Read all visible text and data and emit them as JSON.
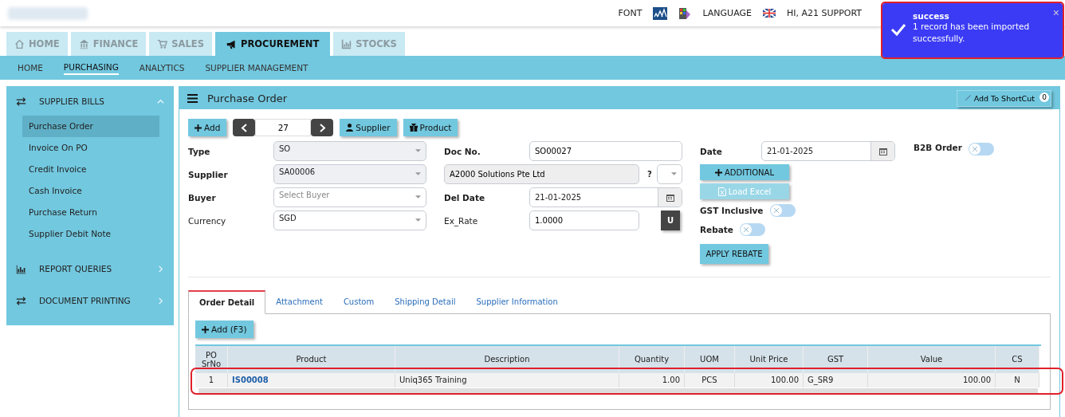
{
  "header": {
    "font_label": "FONT",
    "language_label": "LANGUAGE",
    "user": "HI, A21 SUPPORT"
  },
  "toast": {
    "title": "success",
    "message": "1 record has been imported successfully.",
    "close": "×",
    "highlighted": true
  },
  "module_tabs": [
    {
      "label": "HOME",
      "selected": false
    },
    {
      "label": "FINANCE",
      "selected": false
    },
    {
      "label": "SALES",
      "selected": false
    },
    {
      "label": "PROCUREMENT",
      "selected": true
    },
    {
      "label": "STOCKS",
      "selected": false
    }
  ],
  "sub_nav": [
    {
      "label": "HOME",
      "selected": false
    },
    {
      "label": "PURCHASING",
      "selected": true
    },
    {
      "label": "ANALYTICS",
      "selected": false
    },
    {
      "label": "SUPPLIER MANAGEMENT",
      "selected": false
    }
  ],
  "sidebar": {
    "groups": [
      {
        "label": "SUPPLIER BILLS",
        "expanded": true,
        "items": [
          {
            "label": "Purchase Order",
            "selected": true
          },
          {
            "label": "Invoice On PO",
            "selected": false
          },
          {
            "label": "Credit Invoice",
            "selected": false
          },
          {
            "label": "Cash Invoice",
            "selected": false
          },
          {
            "label": "Purchase Return",
            "selected": false
          },
          {
            "label": "Supplier Debit Note",
            "selected": false
          }
        ]
      },
      {
        "label": "REPORT QUERIES",
        "expanded": false
      },
      {
        "label": "DOCUMENT PRINTING",
        "expanded": false
      }
    ]
  },
  "panel": {
    "title": "Purchase Order",
    "shortcut_button": "Add To ShortCut",
    "shortcut_count": "0"
  },
  "toolbar": {
    "add": "Add",
    "record_number": "27",
    "supplier": "Supplier",
    "product": "Product"
  },
  "form": {
    "type": {
      "label": "Type",
      "value": "SO"
    },
    "supplier": {
      "label": "Supplier",
      "value": "SA00006"
    },
    "buyer": {
      "label": "Buyer",
      "placeholder": "Select Buyer"
    },
    "currency": {
      "label": "Currency",
      "value": "SGD"
    },
    "doc_no": {
      "label": "Doc No.",
      "value": "SO00027"
    },
    "supplier_name": {
      "value": "A2000 Solutions Pte Ltd",
      "help": "?"
    },
    "del_date": {
      "label": "Del Date",
      "value": "21-01-2025"
    },
    "ex_rate": {
      "label": "Ex_Rate",
      "value": "1.0000",
      "button": "U"
    },
    "date": {
      "label": "Date",
      "value": "21-01-2025"
    },
    "additional_button": "ADDITIONAL",
    "load_excel_button": "Load Excel",
    "gst_inclusive": {
      "label": "GST Inclusive",
      "on": false
    },
    "rebate": {
      "label": "Rebate",
      "on": false
    },
    "apply_rebate_button": "APPLY REBATE",
    "b2b_order": {
      "label": "B2B Order",
      "on": false
    }
  },
  "detail_tabs": [
    {
      "label": "Order Detail",
      "selected": true
    },
    {
      "label": "Attachment",
      "selected": false
    },
    {
      "label": "Custom",
      "selected": false
    },
    {
      "label": "Shipping Detail",
      "selected": false
    },
    {
      "label": "Supplier Information",
      "selected": false
    }
  ],
  "table": {
    "add_button": "Add (F3)",
    "columns": [
      "PO\nSrNo",
      "Product",
      "Description",
      "Quantity",
      "UOM",
      "Unit Price",
      "GST",
      "Value",
      "CS"
    ],
    "rows": [
      {
        "highlighted": true,
        "cells": [
          "1",
          "IS00008",
          "Uniq365 Training",
          "1.00",
          "PCS",
          "100.00",
          "G_SR9",
          "100.00",
          "N"
        ]
      }
    ]
  }
}
